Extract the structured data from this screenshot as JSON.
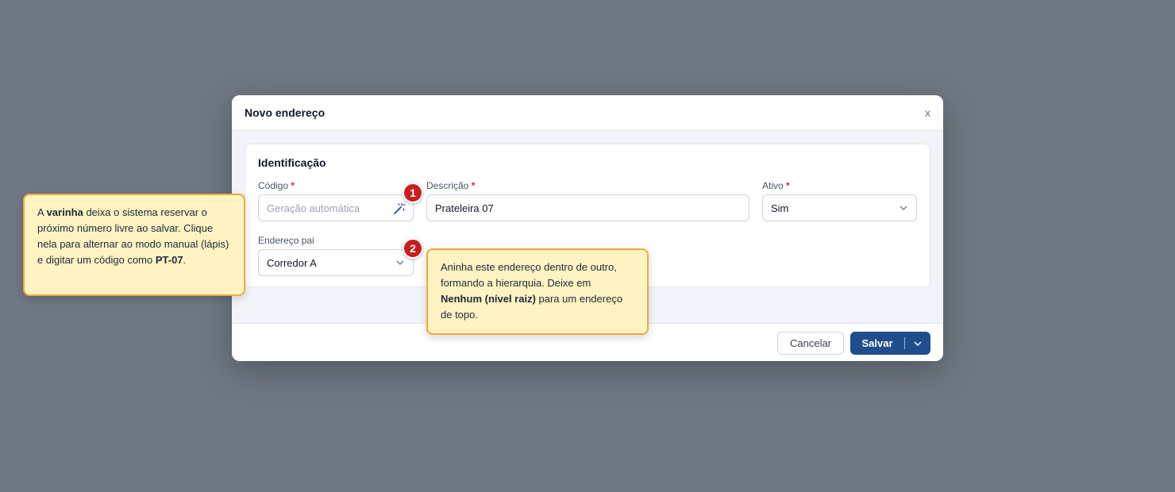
{
  "modal": {
    "title": "Novo endereço",
    "close_label": "x"
  },
  "section": {
    "title": "Identificação"
  },
  "fields": {
    "codigo": {
      "label": "Código",
      "required_mark": "*",
      "placeholder": "Geração automática",
      "value": ""
    },
    "descricao": {
      "label": "Descrição",
      "required_mark": "*",
      "value": "Prateleira 07"
    },
    "ativo": {
      "label": "Ativo",
      "required_mark": "*",
      "value": "Sim"
    },
    "endereco_pai": {
      "label": "Endereço pai",
      "value": "Corredor A"
    }
  },
  "footer": {
    "cancel_label": "Cancelar",
    "save_label": "Salvar"
  },
  "badges": {
    "one": "1",
    "two": "2"
  },
  "tips": {
    "tip1": {
      "t1": "A ",
      "b1": "varinha",
      "t2": " deixa o sistema reservar o próximo número livre ao salvar. Clique nela para alternar ao modo manual (lápis) e digitar um código como ",
      "b2": "PT-07",
      "t3": "."
    },
    "tip2": {
      "t1": "Aninha este endereço dentro de outro, formando a hierarquia. Deixe em ",
      "b1": "Nenhum (nível raiz)",
      "t2": " para um endereço de topo."
    }
  },
  "colors": {
    "backdrop": "#6e7783",
    "primary": "#1f4e8c",
    "badge": "#c81e1e",
    "tip_bg": "#fff3c4",
    "tip_border": "#f0a93a",
    "required": "#dc2626"
  },
  "icons": {
    "wand": "magic-wand-icon",
    "chevron": "chevron-down-icon",
    "close": "close-icon"
  }
}
